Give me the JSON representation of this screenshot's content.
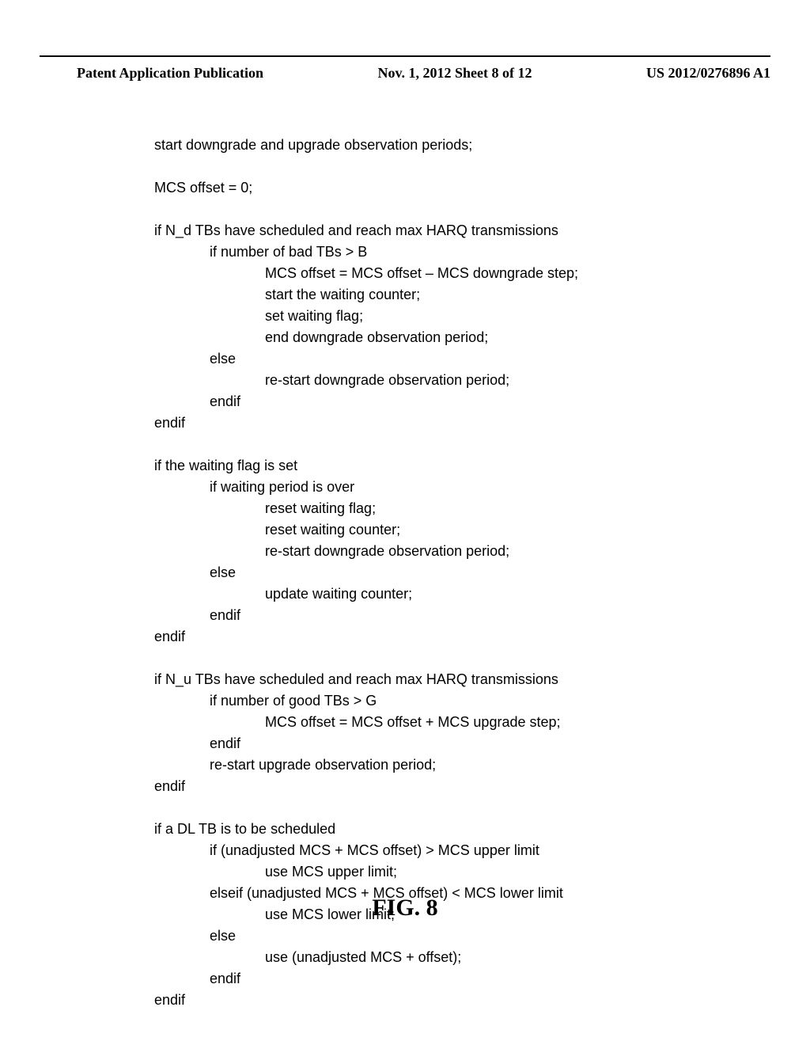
{
  "header": {
    "left": "Patent Application Publication",
    "center": "Nov. 1, 2012   Sheet 8 of 12",
    "right": "US 2012/0276896 A1"
  },
  "code": {
    "l1": "start downgrade and upgrade observation periods;",
    "l2": "MCS offset = 0;",
    "l3": "if N_d TBs have scheduled and reach max HARQ transmissions",
    "l4": "if number of bad TBs > B",
    "l5": "MCS offset = MCS offset – MCS downgrade step;",
    "l6": "start the waiting counter;",
    "l7": "set waiting flag;",
    "l8": "end downgrade observation period;",
    "l9": "else",
    "l10": "re-start downgrade observation period;",
    "l11": "endif",
    "l12": "endif",
    "l13": "if the waiting flag is set",
    "l14": "if waiting period is over",
    "l15": "reset waiting flag;",
    "l16": "reset waiting counter;",
    "l17": "re-start downgrade observation period;",
    "l18": "else",
    "l19": "update waiting counter;",
    "l20": "endif",
    "l21": "endif",
    "l22": "if N_u TBs have scheduled and reach max HARQ transmissions",
    "l23": "if number of good TBs > G",
    "l24": "MCS offset = MCS offset + MCS upgrade step;",
    "l25": "endif",
    "l26": "re-start upgrade observation period;",
    "l27": "endif",
    "l28": "if a DL TB is to be scheduled",
    "l29": "if (unadjusted MCS + MCS offset) > MCS upper limit",
    "l30": "use MCS upper limit;",
    "l31": "elseif (unadjusted MCS + MCS offset) < MCS lower limit",
    "l32": "use MCS lower limit;",
    "l33": "else",
    "l34": "use (unadjusted MCS + offset);",
    "l35": "endif",
    "l36": "endif"
  },
  "figure": "FIG. 8"
}
